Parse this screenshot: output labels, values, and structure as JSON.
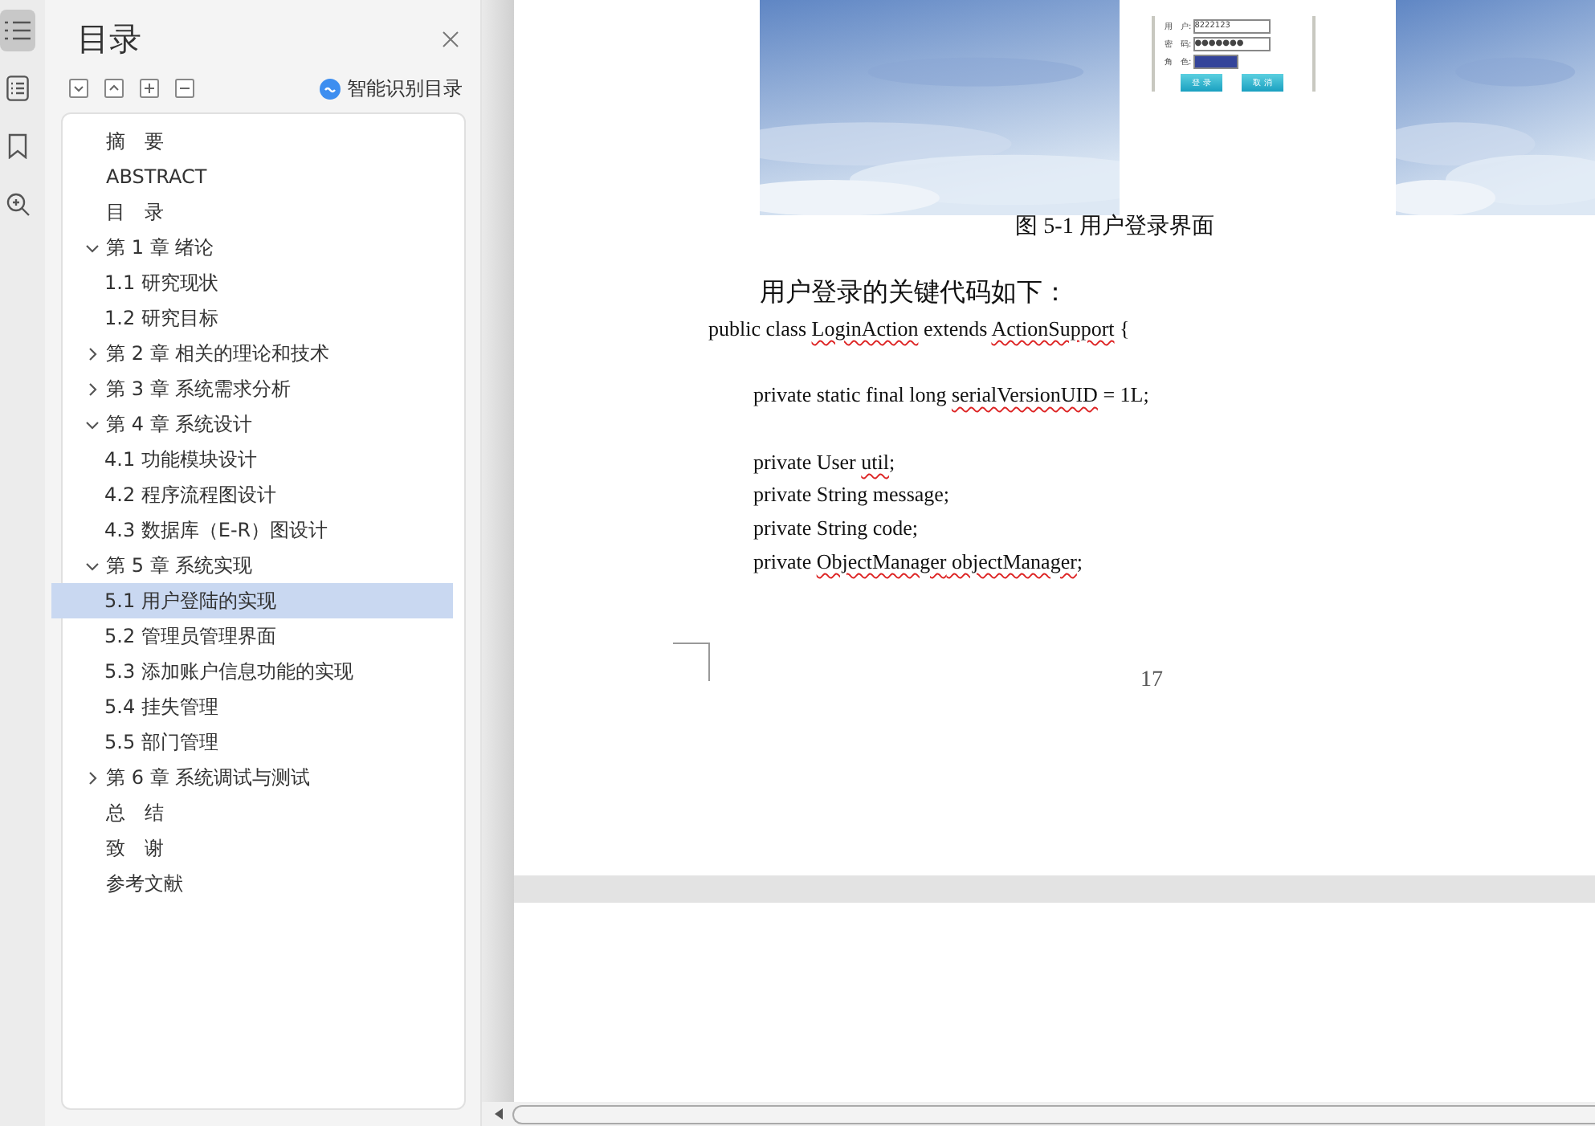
{
  "sidebar": {
    "title": "目录",
    "smart_button": "智能识别目录",
    "toc": [
      {
        "label": "摘　要",
        "selected": false
      },
      {
        "label": "ABSTRACT",
        "selected": false
      },
      {
        "label": "目　录",
        "selected": false
      },
      {
        "label": "第 1 章  绪论",
        "selected": false,
        "expanded": true,
        "children": [
          {
            "label": "1.1 研究现状",
            "selected": false
          },
          {
            "label": "1.2 研究目标",
            "selected": false
          }
        ]
      },
      {
        "label": "第 2 章  相关的理论和技术",
        "selected": false,
        "expanded": false
      },
      {
        "label": "第 3 章  系统需求分析",
        "selected": false,
        "expanded": false
      },
      {
        "label": "第 4 章  系统设计",
        "selected": false,
        "expanded": true,
        "children": [
          {
            "label": "4.1 功能模块设计",
            "selected": false
          },
          {
            "label": "4.2  程序流程图设计",
            "selected": false
          },
          {
            "label": "4.3  数据库（E-R）图设计",
            "selected": false
          }
        ]
      },
      {
        "label": "第 5 章  系统实现",
        "selected": false,
        "expanded": true,
        "children": [
          {
            "label": "5.1 用户登陆的实现",
            "selected": true
          },
          {
            "label": "5.2  管理员管理界面",
            "selected": false
          },
          {
            "label": "5.3 添加账户信息功能的实现",
            "selected": false
          },
          {
            "label": "5.4  挂失管理",
            "selected": false
          },
          {
            "label": "5.5  部门管理",
            "selected": false
          }
        ]
      },
      {
        "label": "第 6 章  系统调试与测试",
        "selected": false,
        "expanded": false
      },
      {
        "label": "总　结",
        "selected": false
      },
      {
        "label": "致　谢",
        "selected": false
      },
      {
        "label": "参考文献",
        "selected": false
      }
    ]
  },
  "document": {
    "figure": {
      "form": [
        {
          "label": "用　户:",
          "value": "8222123"
        },
        {
          "label": "密　码:",
          "value": "●●●●●●●"
        },
        {
          "label": "角　色:"
        }
      ],
      "buttons": [
        "登 录",
        "取 消"
      ]
    },
    "caption": "图  5-1  用户登录界面",
    "paragraph": "用户登录的关键代码如下：",
    "code": [
      {
        "kind": "line",
        "indent": false,
        "segments": [
          {
            "text": "public class "
          },
          {
            "text": "LoginAction",
            "flagged": true
          },
          {
            "text": " extends "
          },
          {
            "text": "ActionSupport",
            "flagged": true
          },
          {
            "text": " {"
          }
        ]
      },
      {
        "kind": "blank"
      },
      {
        "kind": "line",
        "indent": true,
        "segments": [
          {
            "text": "private static final long "
          },
          {
            "text": "serialVersionUID",
            "flagged": true
          },
          {
            "text": " = 1L;"
          }
        ]
      },
      {
        "kind": "blank"
      },
      {
        "kind": "line",
        "indent": true,
        "segments": [
          {
            "text": "private User "
          },
          {
            "text": "util",
            "flagged": true
          },
          {
            "text": ";"
          }
        ]
      },
      {
        "kind": "line",
        "indent": true,
        "segments": [
          {
            "text": "private String message;"
          }
        ]
      },
      {
        "kind": "line",
        "indent": true,
        "segments": [
          {
            "text": "private String code;"
          }
        ]
      },
      {
        "kind": "line",
        "indent": true,
        "segments": [
          {
            "text": "private "
          },
          {
            "text": "ObjectManager",
            "flagged": true
          },
          {
            "text": " objectManager",
            "flagged": true
          },
          {
            "text": ";"
          }
        ]
      }
    ],
    "page_number": "17"
  }
}
